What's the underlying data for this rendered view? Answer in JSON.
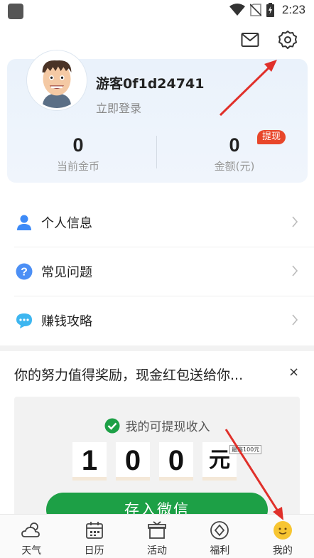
{
  "status_bar": {
    "time": "2:23"
  },
  "header": {
    "mail_icon": "mail-icon",
    "settings_icon": "gear-icon"
  },
  "profile": {
    "username": "游客0f1d24741",
    "login_link": "立即登录",
    "coins": {
      "value": "0",
      "label": "当前金币"
    },
    "amount": {
      "value": "0",
      "label": "金额(元)",
      "badge": "提现"
    }
  },
  "menu": {
    "items": [
      {
        "label": "个人信息",
        "icon": "person-icon"
      },
      {
        "label": "常见问题",
        "icon": "question-icon"
      },
      {
        "label": "赚钱攻略",
        "icon": "chat-bubble-icon"
      }
    ]
  },
  "promo": {
    "title": "你的努力值得奖励，现金红包送给你...",
    "close": "×",
    "income_label": "我的可提现收入",
    "digits": [
      "1",
      "0",
      "0",
      "元"
    ],
    "max_note": "最高100元",
    "button": "存入微信"
  },
  "bottom_nav": {
    "items": [
      {
        "label": "天气",
        "icon": "weather-icon"
      },
      {
        "label": "日历",
        "icon": "calendar-icon"
      },
      {
        "label": "活动",
        "icon": "gift-icon"
      },
      {
        "label": "福利",
        "icon": "diamond-icon"
      },
      {
        "label": "我的",
        "icon": "profile-face-icon"
      }
    ]
  },
  "colors": {
    "accent_green": "#1da046",
    "badge_red": "#e8462a",
    "card_bg": "#eaf2fb",
    "annotation_red": "#e0302a"
  }
}
